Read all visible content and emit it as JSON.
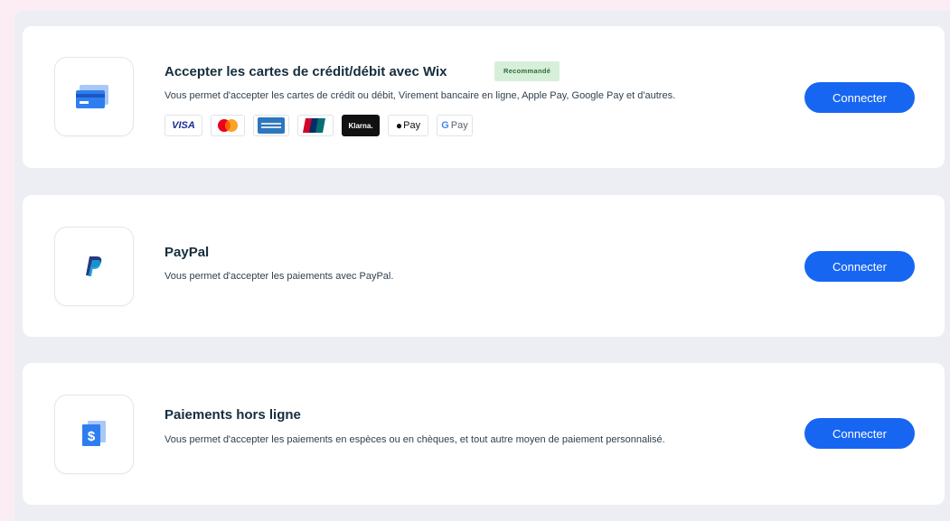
{
  "colors": {
    "accent": "#1766f2",
    "badge_bg": "#d6efd9",
    "card_bg": "#ffffff",
    "panel_bg": "#eceef3"
  },
  "providers": [
    {
      "title": "Accepter les cartes de crédit/débit avec Wix",
      "badge": "Recommandé",
      "description": "Vous permet d'accepter les cartes de crédit ou débit, Virement bancaire en ligne, Apple Pay, Google Pay et d'autres.",
      "icon": "credit-card-icon",
      "button_label": "Connecter",
      "payment_methods": [
        {
          "name": "visa",
          "label": "VISA"
        },
        {
          "name": "mastercard",
          "label": ""
        },
        {
          "name": "amex",
          "label": ""
        },
        {
          "name": "unionpay",
          "label": ""
        },
        {
          "name": "klarna",
          "label": "Klarna."
        },
        {
          "name": "apple-pay",
          "label": "Pay"
        },
        {
          "name": "google-pay",
          "label": "Pay"
        }
      ]
    },
    {
      "title": "PayPal",
      "description": "Vous permet d'accepter les paiements avec PayPal.",
      "icon": "paypal-icon",
      "button_label": "Connecter"
    },
    {
      "title": "Paiements hors ligne",
      "description": "Vous permet d'accepter les paiements en espèces ou en chèques, et tout autre moyen de paiement personnalisé.",
      "icon": "dollar-bill-icon",
      "button_label": "Connecter"
    }
  ]
}
